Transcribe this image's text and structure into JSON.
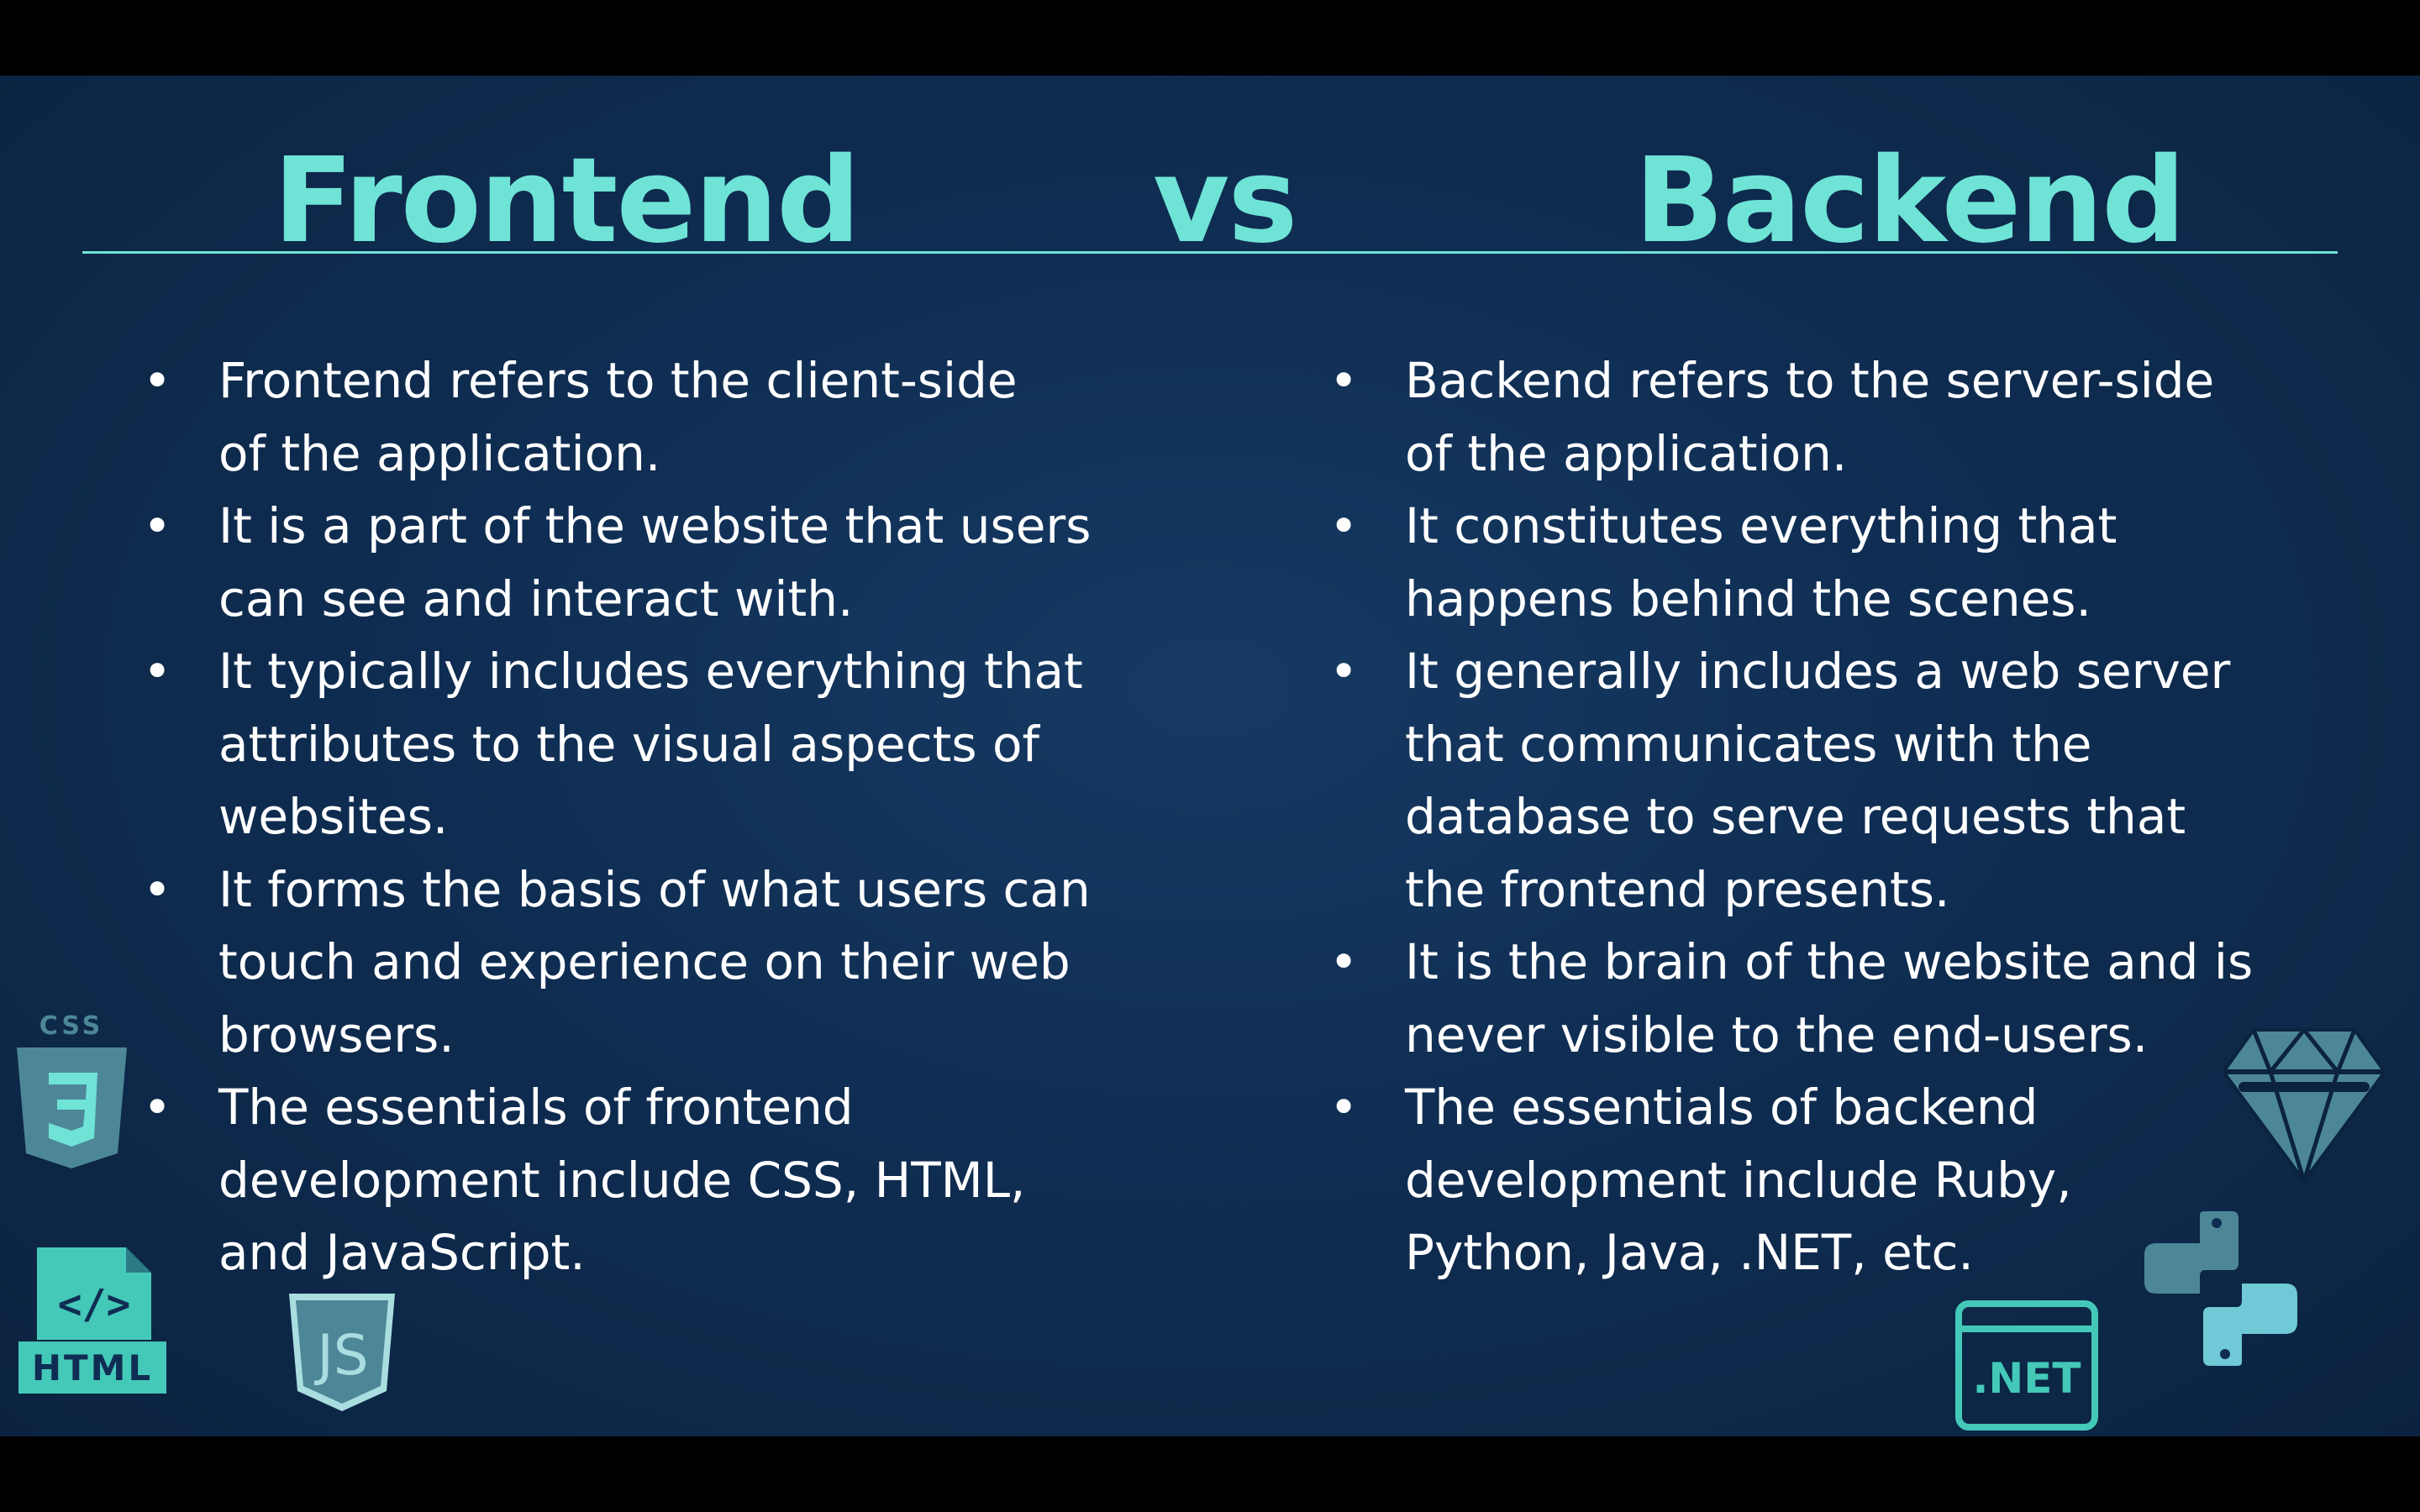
{
  "slide": {
    "title_left": "Frontend",
    "title_mid": "vs",
    "title_right": "Backend",
    "accent_color": "#6fe3d6",
    "background_color": "#0f2d52"
  },
  "frontend": {
    "bullets": [
      {
        "lines": [
          "Frontend refers to the client-side",
          "of the application."
        ]
      },
      {
        "lines": [
          "It is a part of the website that users",
          "can see and interact with."
        ]
      },
      {
        "lines": [
          "It typically includes everything that",
          "attributes to the visual aspects of",
          "websites."
        ]
      },
      {
        "lines": [
          "It forms the basis of what users can",
          "touch and experience on their web",
          "browsers."
        ]
      },
      {
        "lines": [
          "The essentials of frontend",
          "development include CSS, HTML,",
          "and JavaScript."
        ]
      }
    ]
  },
  "backend": {
    "bullets": [
      {
        "lines": [
          "Backend refers to the server-side",
          "of the application."
        ]
      },
      {
        "lines": [
          "It constitutes everything that",
          "happens behind the scenes."
        ]
      },
      {
        "lines": [
          "It generally includes a web server",
          "that communicates with the",
          "database to serve requests that",
          "the frontend presents."
        ]
      },
      {
        "lines": [
          "It is the brain of the website and is",
          "never visible to the end-users."
        ]
      },
      {
        "lines": [
          "The essentials of backend",
          "development include Ruby,",
          "Python, Java, .NET, etc."
        ]
      }
    ]
  },
  "icons": {
    "css_label": "CSS",
    "html_label": "HTML",
    "html_tag": "</>",
    "js_label": "JS",
    "net_label": ".NET",
    "items": [
      "css3-icon",
      "html-icon",
      "javascript-icon",
      "ruby-icon",
      "python-icon",
      "dotnet-icon"
    ]
  }
}
